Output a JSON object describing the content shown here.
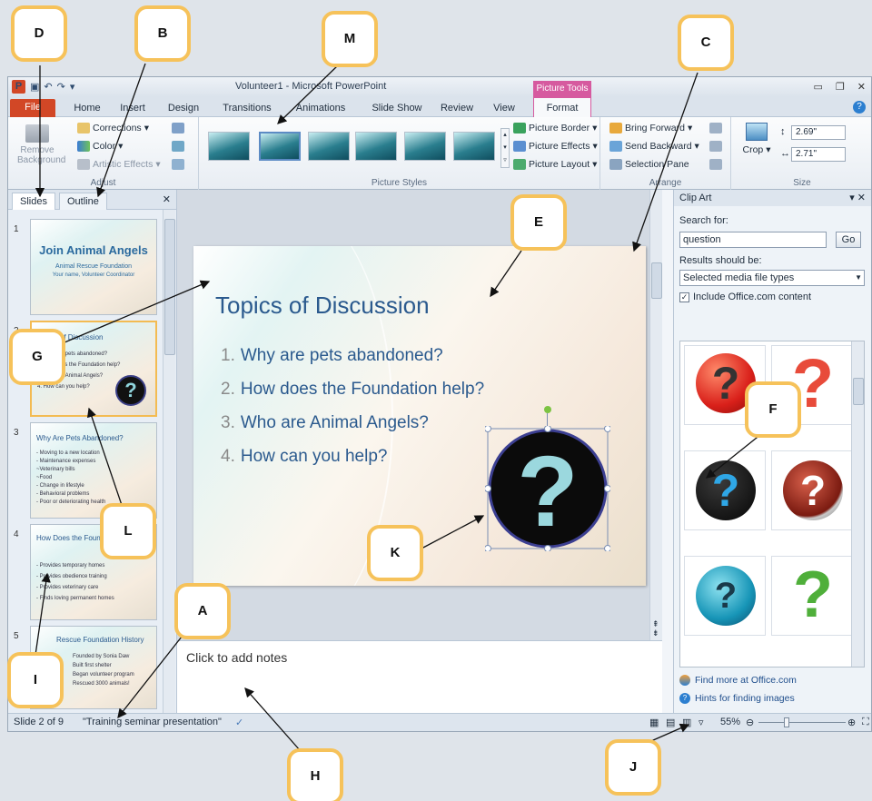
{
  "window": {
    "title": "Volunteer1 - Microsoft PowerPoint",
    "contextual_tab_group": "Picture Tools"
  },
  "tabs": [
    "File",
    "Home",
    "Insert",
    "Design",
    "Transitions",
    "Animations",
    "Slide Show",
    "Review",
    "View",
    "Format"
  ],
  "ribbon": {
    "adjust": {
      "label": "Adjust",
      "remove_background": "Remove Background",
      "corrections": "Corrections",
      "color": "Color",
      "artistic_effects": "Artistic Effects"
    },
    "picture_styles": {
      "label": "Picture Styles",
      "picture_border": "Picture Border",
      "picture_effects": "Picture Effects",
      "picture_layout": "Picture Layout"
    },
    "arrange": {
      "label": "Arrange",
      "bring_forward": "Bring Forward",
      "send_backward": "Send Backward",
      "selection_pane": "Selection Pane"
    },
    "size": {
      "label": "Size",
      "crop": "Crop",
      "height": "2.69\"",
      "width": "2.71\""
    }
  },
  "pane": {
    "slides_tab": "Slides",
    "outline_tab": "Outline",
    "thumbs": [
      {
        "num": "1",
        "title": "Join Animal Angels",
        "sub1": "Animal Rescue Foundation",
        "sub2": "Your name, Volunteer Coordinator"
      },
      {
        "num": "2",
        "title": "Topics of Discussion",
        "lines": [
          "1. Why are pets abandoned?",
          "2. How does the Foundation help?",
          "3. Who are Animal Angels?",
          "4. How can you help?"
        ]
      },
      {
        "num": "3",
        "title": "Why Are Pets Abandoned?",
        "lines": [
          "- Moving to a new location",
          "- Maintenance expenses",
          "   ~Veterinary bills",
          "   ~Food",
          "- Change in lifestyle",
          "- Behavioral problems",
          "- Poor or deteriorating health"
        ]
      },
      {
        "num": "4",
        "title": "How Does the Foundation Help?",
        "lines": [
          "- Provides temporary homes",
          "- Provides obedience training",
          "- Provides veterinary care",
          "- Finds loving permanent homes"
        ]
      },
      {
        "num": "5",
        "title": "Rescue Foundation History",
        "lines": [
          "Founded by Sonia Daw",
          "Built first shelter",
          "Began volunteer program",
          "Rescued 3000 animals!"
        ]
      }
    ]
  },
  "slide": {
    "title": "Topics of Discussion",
    "items": [
      {
        "num": "1.",
        "text": "Why are pets abandoned?"
      },
      {
        "num": "2.",
        "text": "How does the Foundation help?"
      },
      {
        "num": "3.",
        "text": "Who are Animal Angels?"
      },
      {
        "num": "4.",
        "text": "How can you help?"
      }
    ]
  },
  "notes": {
    "placeholder": "Click to add notes"
  },
  "clipart": {
    "header": "Clip Art",
    "search_label": "Search for:",
    "search_value": "question",
    "go": "Go",
    "results_label": "Results should be:",
    "results_value": "Selected media file types",
    "include_label": "Include Office.com content",
    "include_checked": true,
    "find_more": "Find more at Office.com",
    "hints": "Hints for finding images"
  },
  "status": {
    "slide": "Slide 2 of 9",
    "theme": "\"Training seminar presentation\"",
    "zoom": "55%"
  },
  "callouts": [
    "D",
    "B",
    "M",
    "C",
    "E",
    "G",
    "L",
    "F",
    "K",
    "I",
    "A",
    "H",
    "J"
  ]
}
